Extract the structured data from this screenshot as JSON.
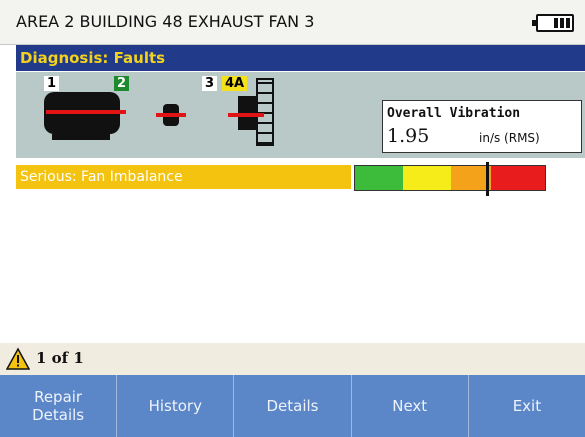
{
  "header": {
    "title": "AREA 2 BUILDING 48 EXHAUST FAN 3",
    "battery_icon": "battery-icon"
  },
  "diagnosis": {
    "label": "Diagnosis: Faults",
    "bar_color": "#213a8a",
    "text_color": "#f3d21e"
  },
  "machine": {
    "points": [
      {
        "label": "1",
        "style": "white"
      },
      {
        "label": "2",
        "style": "green"
      },
      {
        "label": "3",
        "style": "white"
      },
      {
        "label": "4A",
        "style": "yellow"
      }
    ],
    "overall_vibration": {
      "title": "Overall Vibration",
      "value": "1.95",
      "units": "in/s (RMS)"
    }
  },
  "faults": [
    {
      "text": "Serious: Fan Imbalance",
      "color": "#f3c30f",
      "severity_colors": [
        "#3dbb3a",
        "#f5ec1a",
        "#f3a21a",
        "#e81c1c"
      ],
      "severity_level": 0.69
    }
  ],
  "pager": {
    "text": "1 of 1",
    "icon": "warning-icon"
  },
  "buttons": [
    {
      "name": "repair-details-button",
      "label": "Repair\nDetails"
    },
    {
      "name": "history-button",
      "label": "History"
    },
    {
      "name": "details-button",
      "label": "Details"
    },
    {
      "name": "next-button",
      "label": "Next"
    },
    {
      "name": "exit-button",
      "label": "Exit"
    }
  ]
}
